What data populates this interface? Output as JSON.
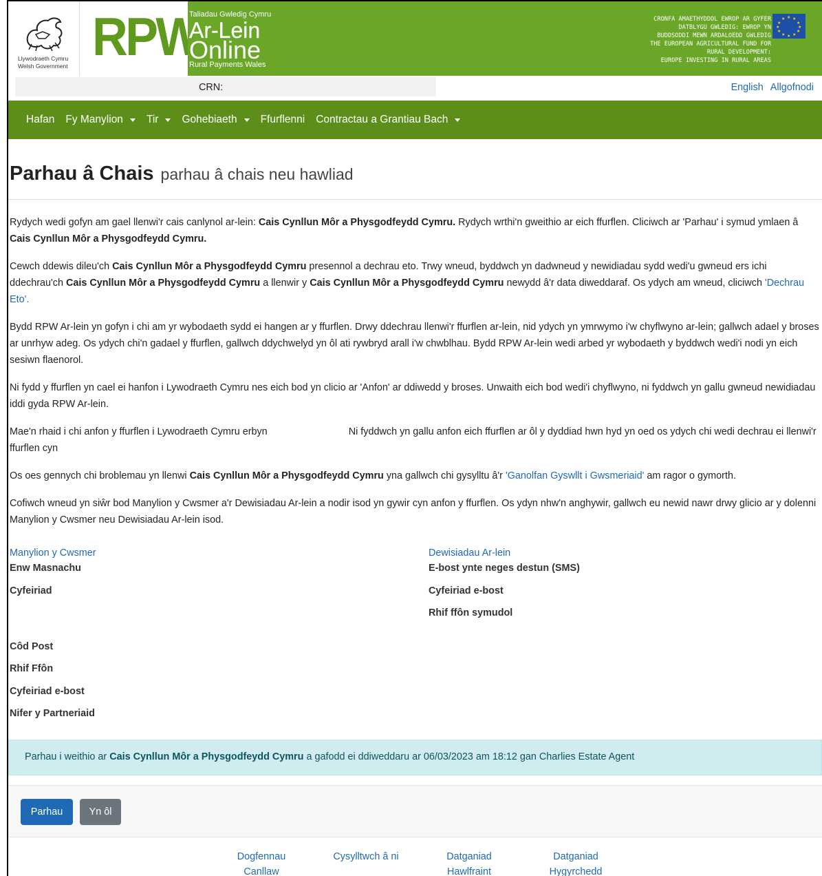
{
  "header": {
    "gov_name_cy": "Llywodraeth Cymru",
    "gov_name_en": "Welsh Government",
    "rpw_letters": "RPW",
    "tagline_cy": "Taliadau Gwledig Cymru",
    "title_cy": "Ar-Lein",
    "title_en": "Online",
    "tagline_en": "Rural Payments Wales",
    "eafrd_lines": [
      "CRONFA AMAETHYDDOL EWROP AR GYFER",
      "DATBLYGU GWLEDIG: EWROP YN",
      "BUDDSODDI MEWN ARDALOEDD GWLEDIG",
      "THE EUROPEAN AGRICULTURAL FUND FOR",
      "RURAL DEVELOPMENT:",
      "EUROPE INVESTING IN RURAL AREAS"
    ],
    "brand_green": "#6aa628",
    "eu_blue": "#1d4ea8"
  },
  "crn_bar": {
    "label": "CRN:",
    "lang_link": "English",
    "logout_link": "Allgofnodi"
  },
  "nav": {
    "items": [
      {
        "label": "Hafan",
        "dropdown": false
      },
      {
        "label": "Fy Manylion",
        "dropdown": true
      },
      {
        "label": "Tir",
        "dropdown": true
      },
      {
        "label": "Gohebiaeth",
        "dropdown": true
      },
      {
        "label": "Ffurflenni",
        "dropdown": false
      },
      {
        "label": "Contractau a Grantiau Bach",
        "dropdown": true
      }
    ],
    "background": "#5e8e1a"
  },
  "page": {
    "title": "Parhau â Chais",
    "subtitle": "parhau â chais neu hawliad"
  },
  "content": {
    "p1_a": "Rydych wedi gofyn am gael llenwi'r cais canlynol ar-lein: ",
    "p1_b": "Cais Cynllun Môr a Physgodfeydd Cymru.",
    "p1_c": " Rydych wrthi'n gweithio ar eich ffurflen. Cliciwch ar 'Parhau' i symud ymlaen â ",
    "p1_d": "Cais Cynllun Môr a Physgodfeydd Cymru.",
    "p2_a": "Cewch ddewis dileu'ch ",
    "p2_b": "Cais Cynllun Môr a Physgodfeydd Cymru",
    "p2_c": " presennol a dechrau eto. Trwy wneud, byddwch yn dadwneud y newidiadau sydd wedi'u gwneud ers ichi ddechrau'ch ",
    "p2_d": "Cais Cynllun Môr a Physgodfeydd Cymru",
    "p2_e": " a llenwir y ",
    "p2_f": "Cais Cynllun Môr a Physgodfeydd Cymru",
    "p2_g": " newydd â'r data diweddaraf. Os ydych am wneud, cliciwch ",
    "p2_link": "'Dechrau Eto'.",
    "p3": "Bydd RPW Ar-lein yn gofyn i chi am yr wybodaeth sydd ei hangen ar y ffurflen. Drwy ddechrau llenwi'r ffurflen ar-lein, nid ydych yn ymrwymo i'w chyflwyno ar-lein; gallwch adael y broses ar unrhyw adeg. Os ydych chi'n gadael y ffurflen, gallwch ddychwelyd yn ôl ati rywbryd arall i'w chwblhau. Bydd RPW Ar-lein wedi arbed yr wybodaeth y byddwch wedi'i nodi yn eich sesiwn flaenorol.",
    "p4": "Ni fydd y ffurflen yn cael ei hanfon i Lywodraeth Cymru nes eich bod yn clicio ar 'Anfon' ar ddiwedd y broses. Unwaith eich bod wedi'i chyflwyno, ni fyddwch yn gallu gwneud newidiadau iddi gyda RPW Ar-lein.",
    "p5_a": "Mae'n rhaid i chi anfon y ffurflen i Lywodraeth Cymru erbyn",
    "p5_b": "Ni fyddwch yn gallu anfon eich ffurflen ar ôl y dyddiad hwn hyd yn oed os ydych chi wedi dechrau ei llenwi'r ffurflen cyn",
    "p6_a": "Os oes gennych chi broblemau yn llenwi ",
    "p6_b": "Cais Cynllun Môr a Physgodfeydd Cymru",
    "p6_c": " yna gallwch chi gysylltu â'r ",
    "p6_link": "'Ganolfan Gyswllt i Gwsmeriaid'",
    "p6_d": " am ragor o gymorth.",
    "p7": "Cofiwch wneud yn siŵr bod Manylion y Cwsmer a'r Dewisiadau Ar-lein a nodir isod yn gywir cyn anfon y ffurflen. Os ydyn nhw'n anghywir, gallwch eu newid nawr drwy glicio ar y dolenni Manylion y Cwsmer neu Dewisiadau Ar-lein isod."
  },
  "customer": {
    "link": "Manylion y Cwsmer",
    "trading_name": "Enw Masnachu",
    "address": "Cyfeiriad",
    "postcode": "Côd Post",
    "phone": "Rhif Ffôn",
    "email": "Cyfeiriad e-bost",
    "partners": "Nifer y Partneriaid"
  },
  "online_prefs": {
    "link": "Dewisiadau Ar-lein",
    "email_or_sms": "E-bost ynte neges destun (SMS)",
    "email_address": "Cyfeiriad e-bost",
    "mobile": "Rhif ffôn symudol"
  },
  "alert": {
    "a": "Parhau i weithio ar ",
    "b": "Cais Cynllun Môr a Physgodfeydd Cymru",
    "c": " a gafodd ei ddiweddaru ar 06/03/2023 am 18:12 gan Charlies Estate Agent"
  },
  "buttons": {
    "continue": "Parhau",
    "back": "Yn ôl"
  },
  "footer": {
    "documents": "Dogfennau Canllaw",
    "contact": "Cysylltwch â ni",
    "copyright": "Datganiad Hawlfraint",
    "privacy": "Datganiad Hygyrchedd"
  }
}
